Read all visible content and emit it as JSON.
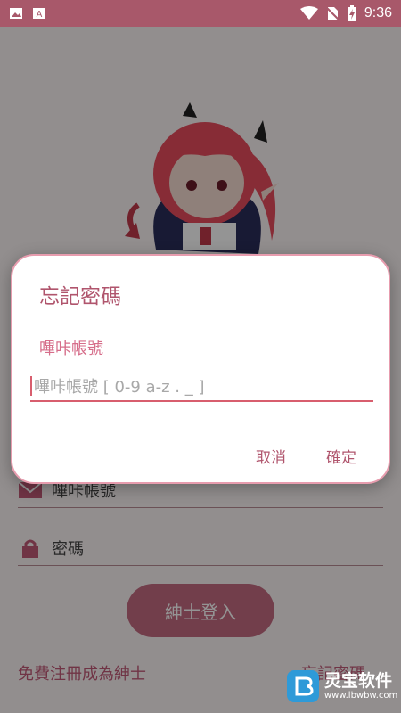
{
  "status_bar": {
    "time": "9:36",
    "icons": [
      "image-icon",
      "a-icon",
      "wifi-icon",
      "no-sim-icon",
      "battery-charging-icon"
    ]
  },
  "login": {
    "account_placeholder": "嗶咔帳號",
    "password_placeholder": "密碼",
    "login_button": "紳士登入",
    "register_link": "免費注冊成為紳士",
    "forgot_link": "忘記密碼"
  },
  "dialog": {
    "title": "忘記密碼",
    "field_label": "嗶咔帳號",
    "input_placeholder": "嗶咔帳號 [ 0-9 a-z . _ ]",
    "input_value": "",
    "cancel_label": "取消",
    "confirm_label": "確定"
  },
  "watermark": {
    "name": "灵宝软件",
    "url": "www.lbwbw.com"
  },
  "colors": {
    "accent": "#b0556d",
    "input_underline": "#d85e6e",
    "status_bar": "#a8586a"
  }
}
